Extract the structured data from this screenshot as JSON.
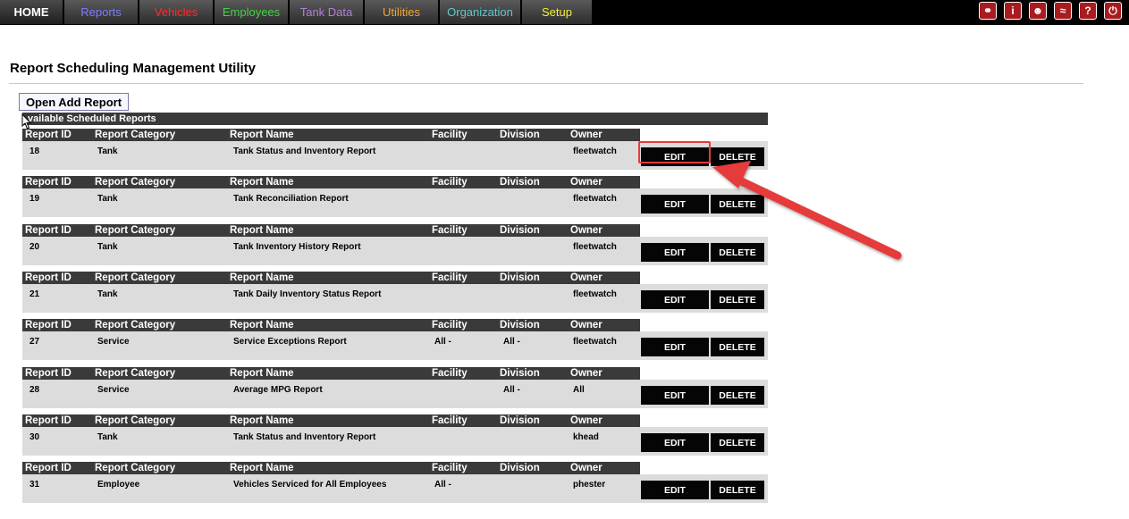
{
  "nav": {
    "tabs": [
      {
        "key": "home",
        "label": "HOME",
        "color": "#ffffff"
      },
      {
        "key": "reports",
        "label": "Reports",
        "color": "#7b7bff"
      },
      {
        "key": "vehicles",
        "label": "Vehicles",
        "color": "#ff2b2b"
      },
      {
        "key": "employees",
        "label": "Employees",
        "color": "#47d147"
      },
      {
        "key": "tank-data",
        "label": "Tank Data",
        "color": "#b57fd6"
      },
      {
        "key": "utilities",
        "label": "Utilities",
        "color": "#f2a534"
      },
      {
        "key": "organization",
        "label": "Organization",
        "color": "#5fc8ce"
      },
      {
        "key": "setup",
        "label": "Setup",
        "color": "#f4ef3a"
      }
    ],
    "icons": [
      {
        "name": "link-icon",
        "glyph": "⚭"
      },
      {
        "name": "info-icon",
        "glyph": "i"
      },
      {
        "name": "user-icon",
        "glyph": "☻"
      },
      {
        "name": "wave-icon",
        "glyph": "≈"
      },
      {
        "name": "help-icon",
        "glyph": "?"
      },
      {
        "name": "power-icon",
        "glyph": "⏻"
      }
    ]
  },
  "page": {
    "title": "Report Scheduling Management Utility",
    "add_button": "Open Add Report",
    "section_header": "vailable Scheduled Reports"
  },
  "columns": {
    "id": "Report ID",
    "category": "Report Category",
    "name": "Report Name",
    "facility": "Facility",
    "division": "Division",
    "owner": "Owner"
  },
  "actions": {
    "edit": "EDIT",
    "delete": "DELETE"
  },
  "reports": [
    {
      "id": "18",
      "category": "Tank",
      "name": "Tank Status and Inventory Report",
      "facility": "",
      "division": "",
      "owner": "fleetwatch"
    },
    {
      "id": "19",
      "category": "Tank",
      "name": "Tank Reconciliation Report",
      "facility": "",
      "division": "",
      "owner": "fleetwatch"
    },
    {
      "id": "20",
      "category": "Tank",
      "name": "Tank Inventory History Report",
      "facility": "",
      "division": "",
      "owner": "fleetwatch"
    },
    {
      "id": "21",
      "category": "Tank",
      "name": "Tank Daily Inventory Status Report",
      "facility": "",
      "division": "",
      "owner": "fleetwatch"
    },
    {
      "id": "27",
      "category": "Service",
      "name": "Service Exceptions Report",
      "facility": "All -",
      "division": "All -",
      "owner": "fleetwatch"
    },
    {
      "id": "28",
      "category": "Service",
      "name": "Average MPG Report",
      "facility": "",
      "division": "All -",
      "owner": "All"
    },
    {
      "id": "30",
      "category": "Tank",
      "name": "Tank Status and Inventory Report",
      "facility": "",
      "division": "",
      "owner": "khead"
    },
    {
      "id": "31",
      "category": "Employee",
      "name": "Vehicles Serviced for All Employees",
      "facility": "All -",
      "division": "",
      "owner": "phester"
    }
  ],
  "annotation": {
    "highlight_color": "#e53b3b",
    "arrow_color": "#e53b3b"
  }
}
